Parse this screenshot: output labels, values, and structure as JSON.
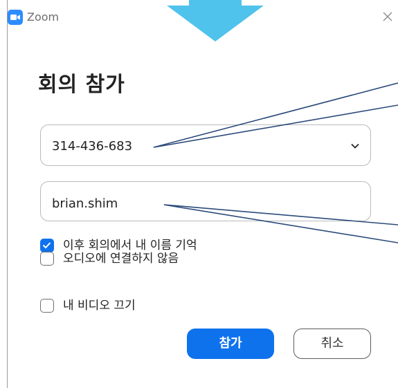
{
  "window": {
    "app_title": "Zoom"
  },
  "main": {
    "title": "회의 참가",
    "meeting_id": {
      "value": "314-436-683"
    },
    "name": {
      "value": "brian.shim"
    },
    "options": [
      {
        "label": "이후 회의에서 내 이름 기억",
        "checked": true
      },
      {
        "label": "오디오에 연결하지 않음",
        "checked": false
      },
      {
        "label": "내 비디오 끄기",
        "checked": false
      }
    ]
  },
  "buttons": {
    "join_label": "참가",
    "cancel_label": "취소"
  },
  "colors": {
    "accent": "#0e72ed",
    "zoom_logo": "#2d8cff",
    "arrow": "#4fc3ec",
    "callout_line": "#2b4a7a"
  },
  "icons": {
    "logo": "zoom-camera-icon",
    "close": "close-icon",
    "dropdown": "chevron-down-icon",
    "check": "checkmark-icon"
  }
}
